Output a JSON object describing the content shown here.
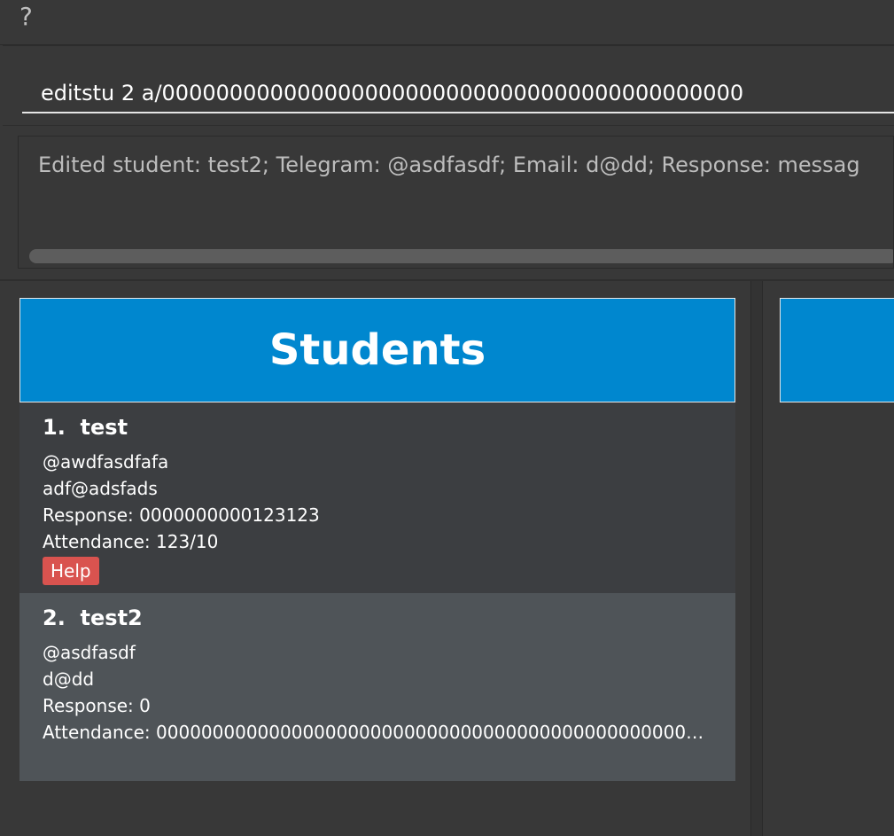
{
  "menu": {
    "help_label": "?"
  },
  "command": {
    "value": "editstu 2 a/0000000000000000000000000000000000000000000"
  },
  "result": {
    "text": "Edited student: test2; Telegram: @asdfasdf; Email: d@dd; Response: messag"
  },
  "students_panel": {
    "title": "Students",
    "items": [
      {
        "index": "1.",
        "name": "test",
        "telegram": "@awdfasdfafa",
        "email": "adf@adsfads",
        "response": "Response: 0000000000123123",
        "attendance": "Attendance: 123/10",
        "tag": "Help"
      },
      {
        "index": "2.",
        "name": "test2",
        "telegram": "@asdfasdf",
        "email": "d@dd",
        "response": "Response: 0",
        "attendance": "Attendance: 000000000000000000000000000000000000000000000000..."
      }
    ]
  },
  "colors": {
    "header_blue": "#0087cf",
    "tag_red": "#d9534f",
    "background": "#383838"
  }
}
